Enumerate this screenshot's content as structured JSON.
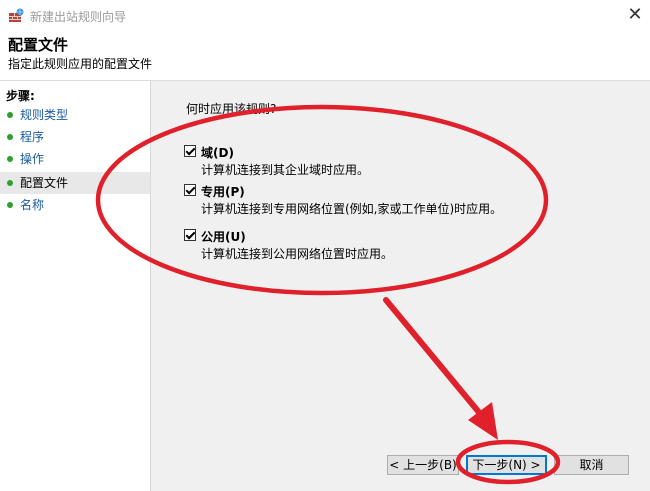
{
  "window": {
    "title": "新建出站规则向导",
    "close_glyph": "✕"
  },
  "header": {
    "title": "配置文件",
    "description": "指定此规则应用的配置文件"
  },
  "sidebar": {
    "title": "步骤:",
    "items": [
      {
        "label": "规则类型",
        "active": false
      },
      {
        "label": "程序",
        "active": false
      },
      {
        "label": "操作",
        "active": false
      },
      {
        "label": "配置文件",
        "active": true
      },
      {
        "label": "名称",
        "active": false
      }
    ]
  },
  "main": {
    "question": "何时应用该规则?",
    "options": [
      {
        "label": "域(D)",
        "desc": "计算机连接到其企业域时应用。",
        "checked": true
      },
      {
        "label": "专用(P)",
        "desc": "计算机连接到专用网络位置(例如,家或工作单位)时应用。",
        "checked": true
      },
      {
        "label": "公用(U)",
        "desc": "计算机连接到公用网络位置时应用。",
        "checked": true
      }
    ]
  },
  "buttons": {
    "back": "< 上一步(B)",
    "next": "下一步(N) >",
    "cancel": "取消"
  },
  "colors": {
    "annotation": "#e0202a",
    "step_dot": "#2ca02c",
    "step_link": "#1a5aa0"
  }
}
